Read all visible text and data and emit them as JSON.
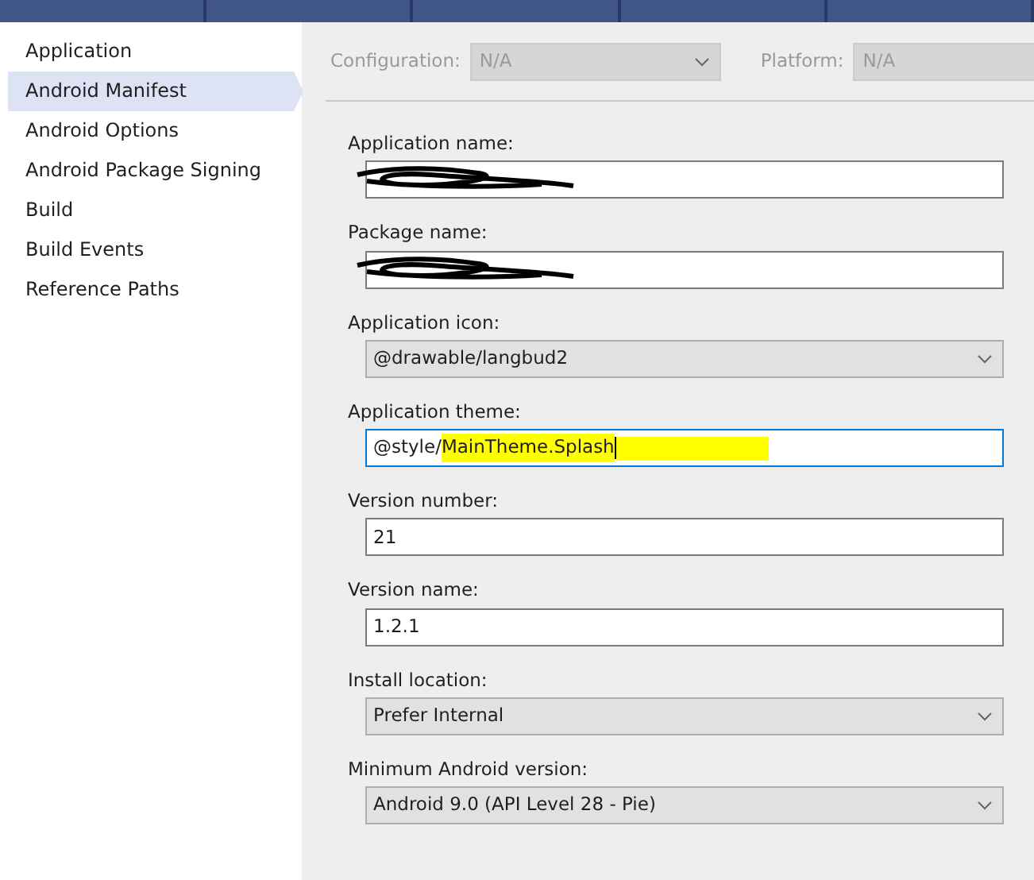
{
  "sidebar": {
    "items": [
      {
        "label": "Application",
        "selected": false
      },
      {
        "label": "Android Manifest",
        "selected": true
      },
      {
        "label": "Android Options",
        "selected": false
      },
      {
        "label": "Android Package Signing",
        "selected": false
      },
      {
        "label": "Build",
        "selected": false
      },
      {
        "label": "Build Events",
        "selected": false
      },
      {
        "label": "Reference Paths",
        "selected": false
      }
    ]
  },
  "toolbar": [
    {
      "label": "Configuration:",
      "value": "N/A",
      "disabled": true
    },
    {
      "label": "Platform:",
      "value": "N/A",
      "disabled": true
    }
  ],
  "form": [
    {
      "kind": "text",
      "label": "Application name:",
      "redacted": true
    },
    {
      "kind": "text",
      "label": "Package name:",
      "redacted": true
    },
    {
      "kind": "select",
      "label": "Application icon:",
      "value": "@drawable/langbud2"
    },
    {
      "kind": "text",
      "label": "Application theme:",
      "focused": true,
      "parts": [
        {
          "text": "@style/",
          "highlighted": false
        },
        {
          "text": "MainTheme.Splash",
          "highlighted": true
        }
      ]
    },
    {
      "kind": "text",
      "label": "Version number:",
      "value": "21"
    },
    {
      "kind": "text",
      "label": "Version name:",
      "value": "1.2.1"
    },
    {
      "kind": "select",
      "label": "Install location:",
      "value": "Prefer Internal"
    },
    {
      "kind": "select",
      "label": "Minimum Android version:",
      "value": "Android 9.0 (API Level 28 - Pie)"
    }
  ]
}
